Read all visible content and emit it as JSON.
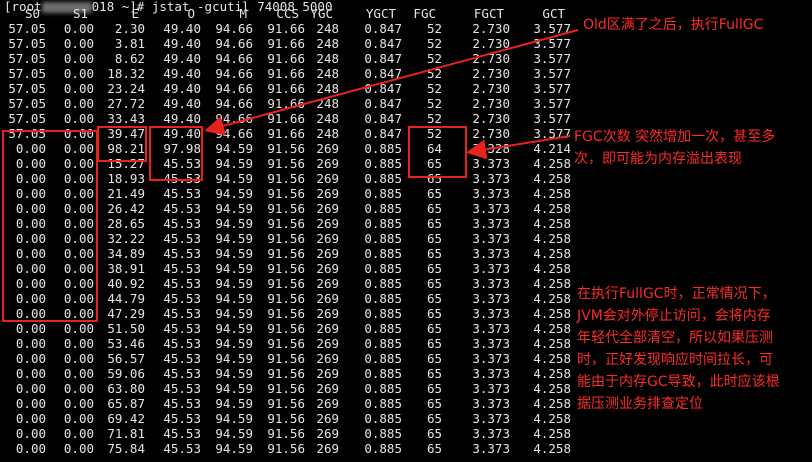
{
  "terminal": {
    "prompt_prefix": "[root",
    "prompt_middle": "018 ~]#",
    "command": "jstat -gcutil 74008 5000",
    "columns": [
      "S0",
      "S1",
      "E",
      "O",
      "M",
      "CCS",
      "YGC",
      "YGCT",
      "FGC",
      "FGCT",
      "GCT"
    ],
    "rows": [
      [
        "57.05",
        "0.00",
        "2.30",
        "49.40",
        "94.66",
        "91.66",
        "248",
        "0.847",
        "52",
        "2.730",
        "3.577"
      ],
      [
        "57.05",
        "0.00",
        "3.81",
        "49.40",
        "94.66",
        "91.66",
        "248",
        "0.847",
        "52",
        "2.730",
        "3.577"
      ],
      [
        "57.05",
        "0.00",
        "8.62",
        "49.40",
        "94.66",
        "91.66",
        "248",
        "0.847",
        "52",
        "2.730",
        "3.577"
      ],
      [
        "57.05",
        "0.00",
        "18.32",
        "49.40",
        "94.66",
        "91.66",
        "248",
        "0.847",
        "52",
        "2.730",
        "3.577"
      ],
      [
        "57.05",
        "0.00",
        "23.24",
        "49.40",
        "94.66",
        "91.66",
        "248",
        "0.847",
        "52",
        "2.730",
        "3.577"
      ],
      [
        "57.05",
        "0.00",
        "27.72",
        "49.40",
        "94.66",
        "91.66",
        "248",
        "0.847",
        "52",
        "2.730",
        "3.577"
      ],
      [
        "57.05",
        "0.00",
        "33.43",
        "49.40",
        "94.66",
        "91.66",
        "248",
        "0.847",
        "52",
        "2.730",
        "3.577"
      ],
      [
        "57.05",
        "0.00",
        "39.47",
        "49.40",
        "94.66",
        "91.66",
        "248",
        "0.847",
        "52",
        "2.730",
        "3.577"
      ],
      [
        "0.00",
        "0.00",
        "98.21",
        "97.98",
        "94.59",
        "91.56",
        "269",
        "0.885",
        "64",
        "3.328",
        "4.214"
      ],
      [
        "0.00",
        "0.00",
        "15.27",
        "45.53",
        "94.59",
        "91.56",
        "269",
        "0.885",
        "65",
        "3.373",
        "4.258"
      ],
      [
        "0.00",
        "0.00",
        "18.93",
        "45.53",
        "94.59",
        "91.56",
        "269",
        "0.885",
        "65",
        "3.373",
        "4.258"
      ],
      [
        "0.00",
        "0.00",
        "21.49",
        "45.53",
        "94.59",
        "91.56",
        "269",
        "0.885",
        "65",
        "3.373",
        "4.258"
      ],
      [
        "0.00",
        "0.00",
        "26.42",
        "45.53",
        "94.59",
        "91.56",
        "269",
        "0.885",
        "65",
        "3.373",
        "4.258"
      ],
      [
        "0.00",
        "0.00",
        "28.65",
        "45.53",
        "94.59",
        "91.56",
        "269",
        "0.885",
        "65",
        "3.373",
        "4.258"
      ],
      [
        "0.00",
        "0.00",
        "32.22",
        "45.53",
        "94.59",
        "91.56",
        "269",
        "0.885",
        "65",
        "3.373",
        "4.258"
      ],
      [
        "0.00",
        "0.00",
        "34.89",
        "45.53",
        "94.59",
        "91.56",
        "269",
        "0.885",
        "65",
        "3.373",
        "4.258"
      ],
      [
        "0.00",
        "0.00",
        "38.91",
        "45.53",
        "94.59",
        "91.56",
        "269",
        "0.885",
        "65",
        "3.373",
        "4.258"
      ],
      [
        "0.00",
        "0.00",
        "40.92",
        "45.53",
        "94.59",
        "91.56",
        "269",
        "0.885",
        "65",
        "3.373",
        "4.258"
      ],
      [
        "0.00",
        "0.00",
        "44.79",
        "45.53",
        "94.59",
        "91.56",
        "269",
        "0.885",
        "65",
        "3.373",
        "4.258"
      ],
      [
        "0.00",
        "0.00",
        "47.29",
        "45.53",
        "94.59",
        "91.56",
        "269",
        "0.885",
        "65",
        "3.373",
        "4.258"
      ],
      [
        "0.00",
        "0.00",
        "51.50",
        "45.53",
        "94.59",
        "91.56",
        "269",
        "0.885",
        "65",
        "3.373",
        "4.258"
      ],
      [
        "0.00",
        "0.00",
        "53.46",
        "45.53",
        "94.59",
        "91.56",
        "269",
        "0.885",
        "65",
        "3.373",
        "4.258"
      ],
      [
        "0.00",
        "0.00",
        "56.57",
        "45.53",
        "94.59",
        "91.56",
        "269",
        "0.885",
        "65",
        "3.373",
        "4.258"
      ],
      [
        "0.00",
        "0.00",
        "59.06",
        "45.53",
        "94.59",
        "91.56",
        "269",
        "0.885",
        "65",
        "3.373",
        "4.258"
      ],
      [
        "0.00",
        "0.00",
        "63.80",
        "45.53",
        "94.59",
        "91.56",
        "269",
        "0.885",
        "65",
        "3.373",
        "4.258"
      ],
      [
        "0.00",
        "0.00",
        "65.87",
        "45.53",
        "94.59",
        "91.56",
        "269",
        "0.885",
        "65",
        "3.373",
        "4.258"
      ],
      [
        "0.00",
        "0.00",
        "69.42",
        "45.53",
        "94.59",
        "91.56",
        "269",
        "0.885",
        "65",
        "3.373",
        "4.258"
      ],
      [
        "0.00",
        "0.00",
        "71.81",
        "45.53",
        "94.59",
        "91.56",
        "269",
        "0.885",
        "65",
        "3.373",
        "4.258"
      ],
      [
        "0.00",
        "0.00",
        "75.84",
        "45.53",
        "94.59",
        "91.56",
        "269",
        "0.885",
        "65",
        "3.373",
        "4.258"
      ]
    ]
  },
  "annotations": {
    "old_full": "Old区满了之后，执行FullGC",
    "fgc_increase_line1": "FGC次数 突然增加一次，甚至多",
    "fgc_increase_line2": "次，即可能为内存溢出表现",
    "fullgc_note_lines": [
      "在执行FullGC时，正常情况下，",
      "JVM会对外停止访问，会将内存",
      "年轻代全部清空，所以如果压测",
      "时，正好发现响应时间拉长，可",
      "能由于内存GC导致，此时应该根",
      "据压测业务排查定位"
    ]
  },
  "colors": {
    "background": "#000000",
    "text": "#e6e6e6",
    "annotation": "#ff2a2a"
  }
}
